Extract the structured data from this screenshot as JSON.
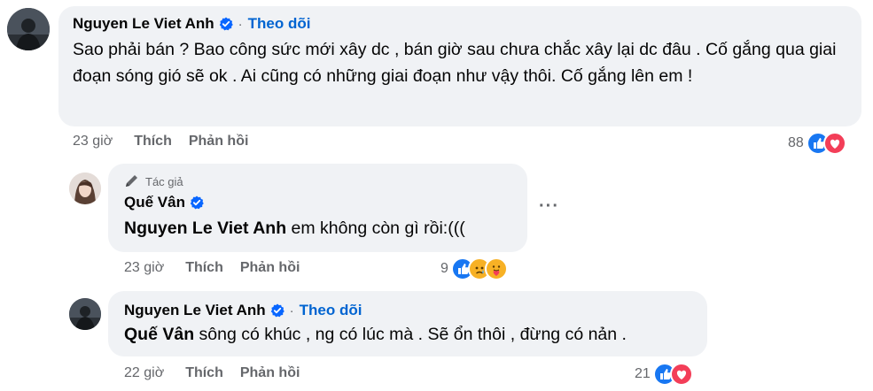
{
  "comments": [
    {
      "author": "Nguyen Le Viet Anh",
      "follow_label": "Theo dõi",
      "separator": "·",
      "text": "Sao phải bán ? Bao công sức mới xây dc , bán giờ sau chưa chắc xây lại dc đâu . Cố gắng qua giai đoạn sóng gió sẽ ok . Ai cũng có những giai đoạn như vậy thôi. Cố gắng lên em !",
      "time": "23 giờ",
      "like_label": "Thích",
      "reply_label": "Phản hồi",
      "reaction_count": "88",
      "reactions": [
        "like-icon",
        "love-icon"
      ]
    },
    {
      "author_badge": "Tác giả",
      "author": "Quế Vân",
      "mention": "Nguyen Le Viet Anh",
      "text": " em không còn gì rồi:(((",
      "more_label": "···",
      "time": "23 giờ",
      "like_label": "Thích",
      "reply_label": "Phản hồi",
      "reaction_count": "9",
      "reactions": [
        "like-icon",
        "sad-icon",
        "care-icon"
      ]
    },
    {
      "author": "Nguyen Le Viet Anh",
      "follow_label": "Theo dõi",
      "separator": "·",
      "mention": "Quế Vân",
      "text": " sông có khúc , ng có lúc mà . Sẽ ổn thôi , đừng có nản .",
      "time": "22 giờ",
      "like_label": "Thích",
      "reply_label": "Phản hồi",
      "reaction_count": "21",
      "reactions": [
        "like-icon",
        "love-icon"
      ]
    }
  ],
  "colors": {
    "bubble": "#f0f2f5",
    "follow": "#0064d1",
    "meta": "#65676b",
    "like": "#1877f2",
    "love": "#f33e58"
  }
}
